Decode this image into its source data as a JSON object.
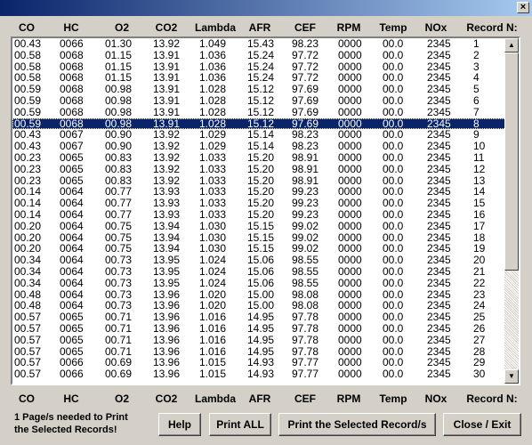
{
  "window": {
    "close_glyph": "×"
  },
  "columns": [
    "CO",
    "HC",
    "O2",
    "CO2",
    "Lambda",
    "AFR",
    "CEF",
    "RPM",
    "Temp",
    "NOx",
    "Record N:"
  ],
  "records": [
    [
      "00.43",
      "0066",
      "01.30",
      "13.92",
      "1.049",
      "15.43",
      "98.23",
      "0000",
      "00.0",
      "2345",
      "1"
    ],
    [
      "00.58",
      "0068",
      "01.15",
      "13.91",
      "1.036",
      "15.24",
      "97.72",
      "0000",
      "00.0",
      "2345",
      "2"
    ],
    [
      "00.58",
      "0068",
      "01.15",
      "13.91",
      "1.036",
      "15.24",
      "97.72",
      "0000",
      "00.0",
      "2345",
      "3"
    ],
    [
      "00.58",
      "0068",
      "01.15",
      "13.91",
      "1.036",
      "15.24",
      "97.72",
      "0000",
      "00.0",
      "2345",
      "4"
    ],
    [
      "00.59",
      "0068",
      "00.98",
      "13.91",
      "1.028",
      "15.12",
      "97.69",
      "0000",
      "00.0",
      "2345",
      "5"
    ],
    [
      "00.59",
      "0068",
      "00.98",
      "13.91",
      "1.028",
      "15.12",
      "97.69",
      "0000",
      "00.0",
      "2345",
      "6"
    ],
    [
      "00.59",
      "0068",
      "00.98",
      "13.91",
      "1.028",
      "15.12",
      "97.69",
      "0000",
      "00.0",
      "2345",
      "7"
    ],
    [
      "00.59",
      "0068",
      "00.98",
      "13.91",
      "1.028",
      "15.12",
      "97.69",
      "0000",
      "00.0",
      "2345",
      "8"
    ],
    [
      "00.43",
      "0067",
      "00.90",
      "13.92",
      "1.029",
      "15.14",
      "98.23",
      "0000",
      "00.0",
      "2345",
      "9"
    ],
    [
      "00.43",
      "0067",
      "00.90",
      "13.92",
      "1.029",
      "15.14",
      "98.23",
      "0000",
      "00.0",
      "2345",
      "10"
    ],
    [
      "00.23",
      "0065",
      "00.83",
      "13.92",
      "1.033",
      "15.20",
      "98.91",
      "0000",
      "00.0",
      "2345",
      "11"
    ],
    [
      "00.23",
      "0065",
      "00.83",
      "13.92",
      "1.033",
      "15.20",
      "98.91",
      "0000",
      "00.0",
      "2345",
      "12"
    ],
    [
      "00.23",
      "0065",
      "00.83",
      "13.92",
      "1.033",
      "15.20",
      "98.91",
      "0000",
      "00.0",
      "2345",
      "13"
    ],
    [
      "00.14",
      "0064",
      "00.77",
      "13.93",
      "1.033",
      "15.20",
      "99.23",
      "0000",
      "00.0",
      "2345",
      "14"
    ],
    [
      "00.14",
      "0064",
      "00.77",
      "13.93",
      "1.033",
      "15.20",
      "99.23",
      "0000",
      "00.0",
      "2345",
      "15"
    ],
    [
      "00.14",
      "0064",
      "00.77",
      "13.93",
      "1.033",
      "15.20",
      "99.23",
      "0000",
      "00.0",
      "2345",
      "16"
    ],
    [
      "00.20",
      "0064",
      "00.75",
      "13.94",
      "1.030",
      "15.15",
      "99.02",
      "0000",
      "00.0",
      "2345",
      "17"
    ],
    [
      "00.20",
      "0064",
      "00.75",
      "13.94",
      "1.030",
      "15.15",
      "99.02",
      "0000",
      "00.0",
      "2345",
      "18"
    ],
    [
      "00.20",
      "0064",
      "00.75",
      "13.94",
      "1.030",
      "15.15",
      "99.02",
      "0000",
      "00.0",
      "2345",
      "19"
    ],
    [
      "00.34",
      "0064",
      "00.73",
      "13.95",
      "1.024",
      "15.06",
      "98.55",
      "0000",
      "00.0",
      "2345",
      "20"
    ],
    [
      "00.34",
      "0064",
      "00.73",
      "13.95",
      "1.024",
      "15.06",
      "98.55",
      "0000",
      "00.0",
      "2345",
      "21"
    ],
    [
      "00.34",
      "0064",
      "00.73",
      "13.95",
      "1.024",
      "15.06",
      "98.55",
      "0000",
      "00.0",
      "2345",
      "22"
    ],
    [
      "00.48",
      "0064",
      "00.73",
      "13.96",
      "1.020",
      "15.00",
      "98.08",
      "0000",
      "00.0",
      "2345",
      "23"
    ],
    [
      "00.48",
      "0064",
      "00.73",
      "13.96",
      "1.020",
      "15.00",
      "98.08",
      "0000",
      "00.0",
      "2345",
      "24"
    ],
    [
      "00.57",
      "0065",
      "00.71",
      "13.96",
      "1.016",
      "14.95",
      "97.78",
      "0000",
      "00.0",
      "2345",
      "25"
    ],
    [
      "00.57",
      "0065",
      "00.71",
      "13.96",
      "1.016",
      "14.95",
      "97.78",
      "0000",
      "00.0",
      "2345",
      "26"
    ],
    [
      "00.57",
      "0065",
      "00.71",
      "13.96",
      "1.016",
      "14.95",
      "97.78",
      "0000",
      "00.0",
      "2345",
      "27"
    ],
    [
      "00.57",
      "0065",
      "00.71",
      "13.96",
      "1.016",
      "14.95",
      "97.78",
      "0000",
      "00.0",
      "2345",
      "28"
    ],
    [
      "00.57",
      "0066",
      "00.69",
      "13.96",
      "1.015",
      "14.93",
      "97.77",
      "0000",
      "00.0",
      "2345",
      "29"
    ],
    [
      "00.57",
      "0066",
      "00.69",
      "13.96",
      "1.015",
      "14.93",
      "97.77",
      "0000",
      "00.0",
      "2345",
      "30"
    ]
  ],
  "selected_record": "8",
  "scrollbar": {
    "up_glyph": "▲",
    "down_glyph": "▼"
  },
  "footer": {
    "info_line1": "1 Page/s needed to Print",
    "info_line2": "the Selected Records!",
    "help_label": "Help",
    "print_all_label": "Print ALL",
    "print_selected_label": "Print the Selected Record/s",
    "close_label": "Close / Exit"
  },
  "colors": {
    "titlebar": "#0a246a",
    "selection": "#0a246a",
    "window": "#d4d0c8"
  }
}
